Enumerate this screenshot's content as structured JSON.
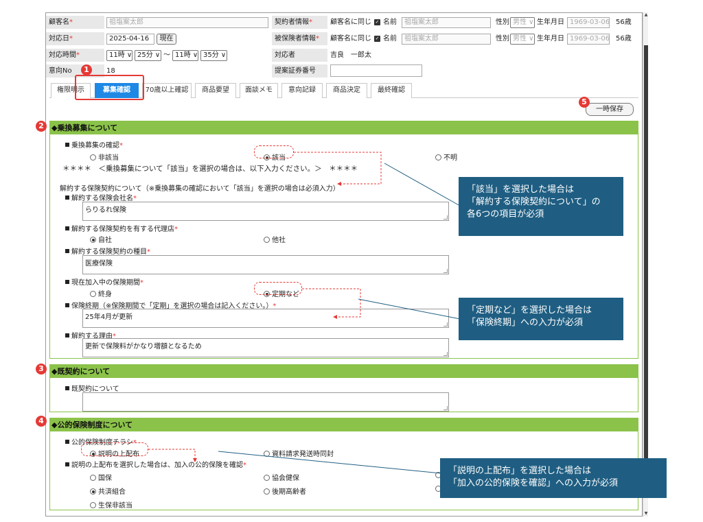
{
  "header": {
    "customer_name": {
      "label": "顧客名",
      "value": "祖塩案太郎"
    },
    "contractor": {
      "label": "契約者情報",
      "same_label": "顧客名に同じ",
      "name_label": "名前",
      "name_value": "祖塩案太郎",
      "gender_label": "性別",
      "gender_value": "男性",
      "birth_label": "生年月日",
      "birth_value": "1969-03-06",
      "age": "56歳"
    },
    "insured": {
      "label": "被保険者情報",
      "same_label": "顧客名に同じ",
      "name_label": "名前",
      "name_value": "祖塩案太郎",
      "gender_label": "性別",
      "gender_value": "男性",
      "birth_label": "生年月日",
      "birth_value": "1969-03-06",
      "age": "56歳"
    },
    "response_date": {
      "label": "対応日",
      "value": "2025-04-16",
      "now_button": "現在"
    },
    "response_time": {
      "label": "対応時間",
      "start_hour": "11時",
      "start_min": "25分",
      "sep": "～",
      "end_hour": "11時",
      "end_min": "35分"
    },
    "handler": {
      "label": "対応者",
      "value": "吉良　一郎太"
    },
    "intent_no": {
      "label": "意向No",
      "value": "18"
    },
    "proposal_no": {
      "label": "提案証券番号",
      "value": ""
    }
  },
  "tabs": [
    "権限明示",
    "募集確認",
    "70歳以上確認",
    "商品要望",
    "面談メモ",
    "意向記録",
    "商品決定",
    "最終確認"
  ],
  "active_tab": "募集確認",
  "save_button": "一時保存",
  "section1": {
    "title": "乗換募集について",
    "q1_label": "乗換募集の確認",
    "q1_options": [
      "非該当",
      "該当",
      "不明"
    ],
    "notice": "＊＊＊＊　＜乗換募集について「該当」を選択の場合は、以下入力ください。＞　＊＊＊＊",
    "sub_heading": "解約する保険契約について（※乗換募集の確認において「該当」を選択の場合は必須入力）",
    "company_label": "解約する保険会社名",
    "company_value": "らりるれ保険",
    "agent_label": "解約する保険契約を有する代理店",
    "agent_options": [
      "自社",
      "他社"
    ],
    "type_label": "解約する保険契約の種目",
    "type_value": "医療保険",
    "period_label": "現在加入中の保険期間",
    "period_options": [
      "終身",
      "定期など"
    ],
    "end_label": "保険終期（※保険期間で「定期」を選択の場合は記入ください。）",
    "end_value": "25年4月が更新",
    "reason_label": "解約する理由",
    "reason_value": "更新で保険料がかなり増額となるため"
  },
  "section2": {
    "title": "既契約について",
    "label": "既契約について",
    "value": ""
  },
  "section3": {
    "title": "公的保険制度について",
    "flyer_label": "公的保険制度チラシ",
    "flyer_options": [
      "説明の上配布",
      "資料請求発送時同封"
    ],
    "confirm_label": "説明の上配布を選択した場合は、加入の公的保険を確認",
    "confirm_options": [
      "国保",
      "協会健保",
      "共済組合",
      "後期高齢者",
      "生保非該当"
    ]
  },
  "callouts": [
    [
      "「該当」を選択した場合は",
      "「解約する保険契約について」の",
      "各6つの項目が必須"
    ],
    [
      "「定期など」を選択した場合は",
      "「保険終期」への入力が必須"
    ],
    [
      "「説明の上配布」を選択した場合は",
      "「加入の公的保険を確認」への入力が必須"
    ]
  ],
  "markers": [
    "1",
    "2",
    "3",
    "4",
    "5"
  ],
  "colors": {
    "accent": "#1e88e5",
    "section": "#8bc34a",
    "highlight": "#e53935",
    "callout": "#1f5e82"
  }
}
